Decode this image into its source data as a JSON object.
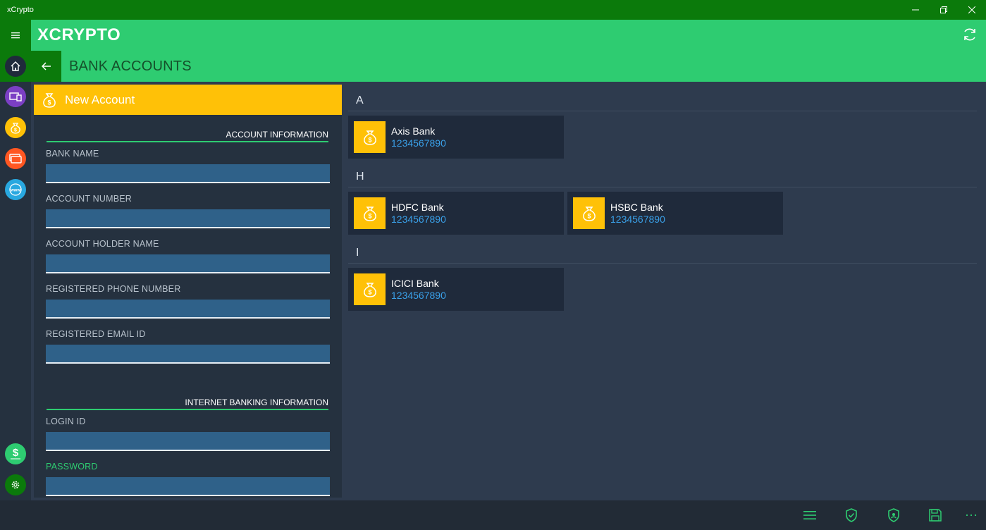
{
  "window": {
    "title": "xCrypto"
  },
  "app": {
    "logo": "XCRYPTO"
  },
  "page": {
    "title": "BANK ACCOUNTS"
  },
  "nav_rail": {
    "items": [
      {
        "icon": "home-icon",
        "color": "#1f2a3b"
      },
      {
        "icon": "device-icon",
        "color": "#7b3fc4"
      },
      {
        "icon": "money-bag-icon",
        "color": "#ffc107"
      },
      {
        "icon": "cards-icon",
        "color": "#ff5722"
      },
      {
        "icon": "www-icon",
        "color": "#29a8e0"
      },
      {
        "icon": "dollar-icon",
        "color": "#2ecc71"
      },
      {
        "icon": "settings-icon",
        "color": "#0b7a0b"
      }
    ]
  },
  "form": {
    "title": "New Account",
    "account_section": "ACCOUNT INFORMATION",
    "internet_section": "INTERNET BANKING INFORMATION",
    "fields": {
      "bank_name": {
        "label": "BANK NAME",
        "value": ""
      },
      "account_number": {
        "label": "ACCOUNT NUMBER",
        "value": ""
      },
      "holder_name": {
        "label": "ACCOUNT HOLDER NAME",
        "value": ""
      },
      "phone": {
        "label": "REGISTERED PHONE NUMBER",
        "value": ""
      },
      "email": {
        "label": "REGISTERED EMAIL ID",
        "value": ""
      },
      "login": {
        "label": "LOGIN ID",
        "value": ""
      },
      "password": {
        "label": "PASSWORD",
        "value": ""
      }
    }
  },
  "accounts": {
    "groups": [
      {
        "letter": "A",
        "items": [
          {
            "name": "Axis Bank",
            "number": "1234567890"
          }
        ]
      },
      {
        "letter": "H",
        "items": [
          {
            "name": "HDFC Bank",
            "number": "1234567890"
          },
          {
            "name": "HSBC Bank",
            "number": "1234567890"
          }
        ]
      },
      {
        "letter": "I",
        "items": [
          {
            "name": "ICICI Bank",
            "number": "1234567890"
          }
        ]
      }
    ]
  },
  "bottom_bar": {
    "icons": [
      "list-icon",
      "shield-check-icon",
      "shield-icon",
      "save-icon",
      "more-icon"
    ]
  },
  "colors": {
    "accent_green": "#2ecc71",
    "dark_green": "#0b7a0b",
    "yellow": "#ffc107",
    "link_blue": "#3aa0e8"
  }
}
